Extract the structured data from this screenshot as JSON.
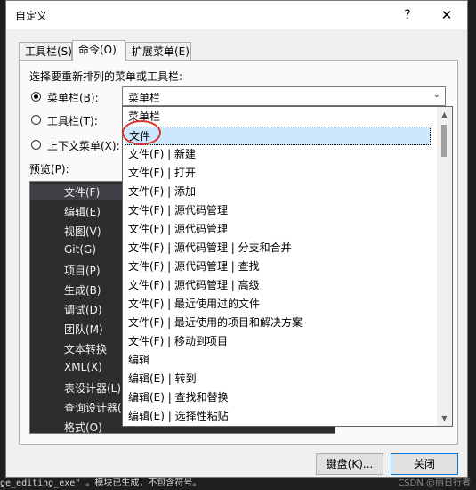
{
  "dialog": {
    "title": "自定义",
    "help_glyph": "?",
    "close_glyph": "✕",
    "tabs": [
      {
        "label": "工具栏(S)"
      },
      {
        "label": "命令(O)"
      },
      {
        "label": "扩展菜单(E)"
      }
    ],
    "active_tab": 1,
    "choose_label": "选择要重新排列的菜单或工具栏:",
    "options": {
      "menu_bar": "菜单栏(B):",
      "toolbar": "工具栏(T):",
      "context_menu": "上下文菜单(X):",
      "selected": "menu_bar"
    },
    "combo_value": "菜单栏",
    "preview_label": "预览(P):",
    "buttons": {
      "keyboard": "键盘(K)...",
      "close": "关闭"
    }
  },
  "preview_items": [
    "文件(F)",
    "编辑(E)",
    "视图(V)",
    "Git(G)",
    "项目(P)",
    "生成(B)",
    "调试(D)",
    "团队(M)",
    "文本转换",
    "XML(X)",
    "表设计器(L)",
    "查询设计器(R)",
    "格式(O)"
  ],
  "dropdown_items": [
    "菜单栏",
    "文件",
    "文件(F) | 新建",
    "文件(F) | 打开",
    "文件(F) | 添加",
    "文件(F) | 源代码管理",
    "文件(F) | 源代码管理",
    "文件(F) | 源代码管理 | 分支和合并",
    "文件(F) | 源代码管理 | 查找",
    "文件(F) | 源代码管理 | 高级",
    "文件(F) | 最近使用过的文件",
    "文件(F) | 最近使用的项目和解决方案",
    "文件(F) | 移动到项目",
    "编辑",
    "编辑(E) | 转到",
    "编辑(E) | 查找和替换",
    "编辑(E) | 选择性粘贴"
  ],
  "dropdown_highlighted": 1,
  "editor_background": {
    "status_text": "ge_editing_exe\" 。模块已生成，不包含符号。",
    "watermark": "CSDN @丽日行者"
  },
  "colors": {
    "highlight_circle": "#e0322c",
    "selection": "#cce8ff",
    "preview_bg": "#2d2d30"
  }
}
